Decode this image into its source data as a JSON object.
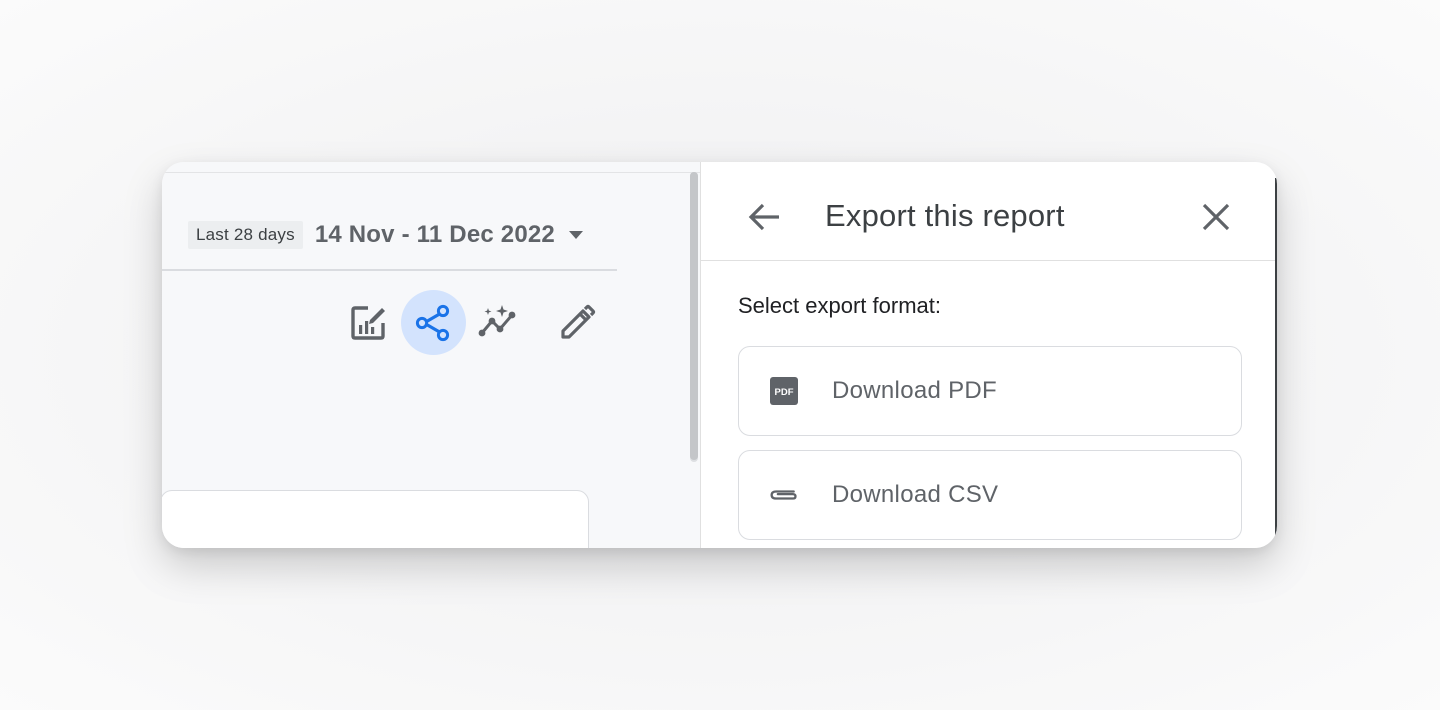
{
  "report": {
    "range_chip": "Last 28 days",
    "date_range": "14 Nov - 11 Dec 2022"
  },
  "toolbar": {
    "icons": [
      "customize-report-icon",
      "share-icon",
      "insights-icon",
      "edit-icon"
    ],
    "active_icon": "share-icon",
    "active_color": "#1a73e8"
  },
  "panel": {
    "title": "Export this report",
    "back_icon": "arrow-back-icon",
    "close_icon": "close-icon",
    "format_label": "Select export format:",
    "options": [
      {
        "label": "Download PDF",
        "icon": "pdf-icon",
        "icon_text": "PDF"
      },
      {
        "label": "Download CSV",
        "icon": "attachment-icon"
      }
    ]
  }
}
